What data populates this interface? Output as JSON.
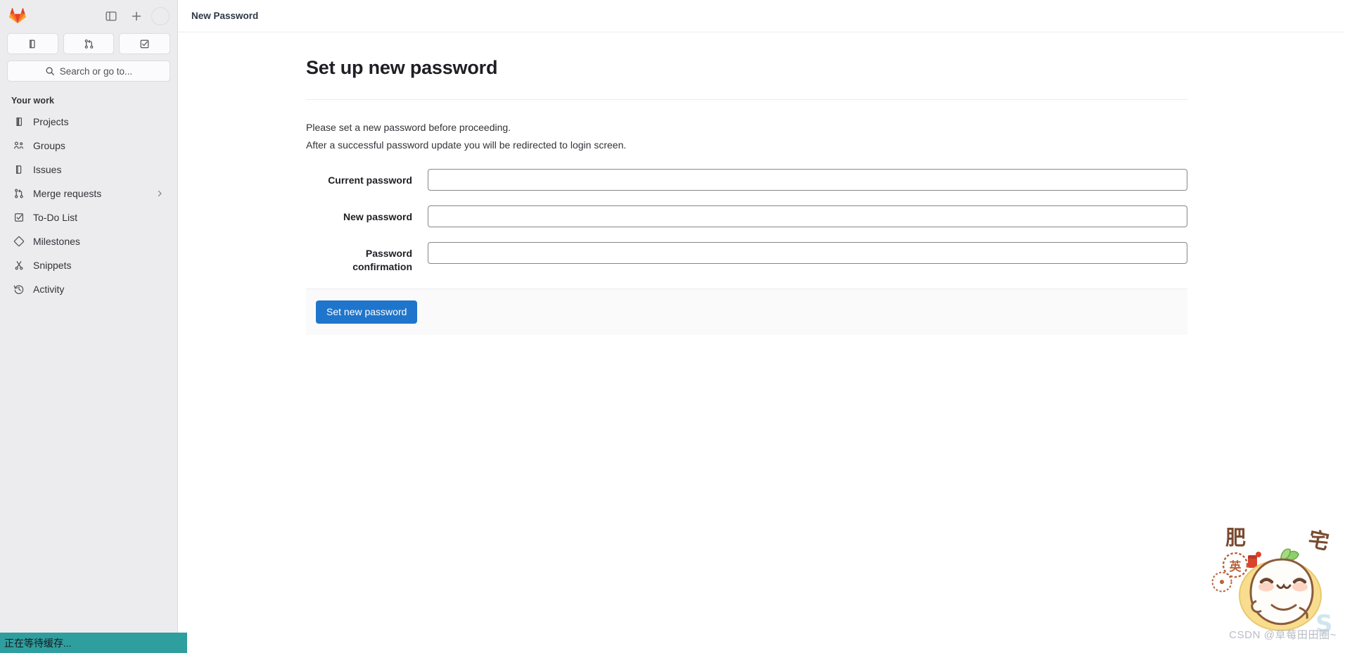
{
  "sidebar": {
    "brand": {
      "icon": "gitlab-logo-icon",
      "color": "#fc6d26"
    },
    "top_actions": [
      {
        "name": "sidebar-toggle-button",
        "icon": "panel-toggle-icon"
      },
      {
        "name": "create-new-button",
        "icon": "plus-icon"
      },
      {
        "name": "user-avatar",
        "icon": "avatar-icon"
      }
    ],
    "quick_actions": [
      {
        "name": "quick-issues-button",
        "icon": "issues-icon"
      },
      {
        "name": "quick-merge-requests-button",
        "icon": "merge-request-icon"
      },
      {
        "name": "quick-todo-button",
        "icon": "todo-checkbox-icon"
      }
    ],
    "search": {
      "icon": "search-icon",
      "label": "Search or go to..."
    },
    "section_title": "Your work",
    "items": [
      {
        "label": "Projects",
        "icon": "project-icon",
        "chevron": false
      },
      {
        "label": "Groups",
        "icon": "group-icon",
        "chevron": false
      },
      {
        "label": "Issues",
        "icon": "issues-icon",
        "chevron": false
      },
      {
        "label": "Merge requests",
        "icon": "merge-request-icon",
        "chevron": true
      },
      {
        "label": "To-Do List",
        "icon": "todo-checkbox-icon",
        "chevron": false
      },
      {
        "label": "Milestones",
        "icon": "milestone-diamond-icon",
        "chevron": false
      },
      {
        "label": "Snippets",
        "icon": "snippet-scissors-icon",
        "chevron": false
      },
      {
        "label": "Activity",
        "icon": "activity-history-icon",
        "chevron": false
      }
    ]
  },
  "topbar": {
    "title": "New Password"
  },
  "main": {
    "heading": "Set up new password",
    "intro": [
      "Please set a new password before proceeding.",
      "After a successful password update you will be redirected to login screen."
    ],
    "form": {
      "fields": [
        {
          "label": "Current password",
          "value": "",
          "placeholder": "",
          "name": "current-password-input"
        },
        {
          "label": "New password",
          "value": "",
          "placeholder": "",
          "name": "new-password-input"
        },
        {
          "label": "Password confirmation",
          "value": "",
          "placeholder": "",
          "name": "password-confirmation-input"
        }
      ],
      "submit_label": "Set new password",
      "submit_color": "#1f75cb"
    }
  },
  "status_bar": {
    "text": "正在等待缓存...",
    "color": "#2f9e9e"
  },
  "overlay": {
    "watermark": "CSDN @草莓田田圈~",
    "mascot_text_top_left": "肥",
    "mascot_text_top_right": "宅",
    "mascot_badge_text": "英"
  }
}
